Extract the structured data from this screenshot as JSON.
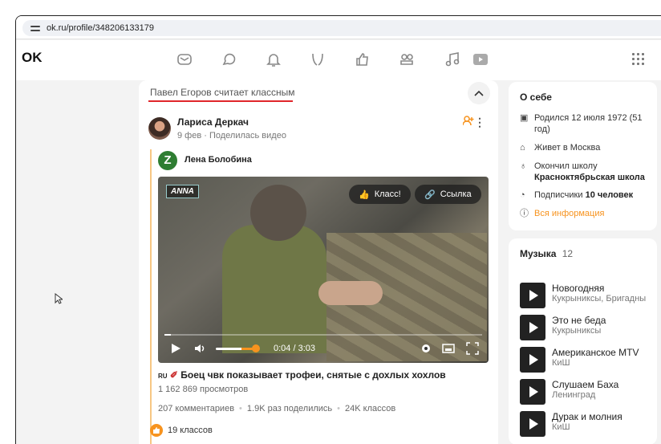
{
  "browser": {
    "url": "ok.ru/profile/348206133179"
  },
  "header": {
    "logo": "OK"
  },
  "feed": {
    "liked_by": "Павел Егоров считает классным",
    "post": {
      "author": "Лариса Деркач",
      "meta": "9 фев · Поделилась видео",
      "repost_author": "Лена Болобина",
      "repost_initial": "Z",
      "video": {
        "channel_logo": "ANNA",
        "like_label": "Класс!",
        "link_label": "Ссылка",
        "time": "0:04 / 3:03",
        "progress": 0.02,
        "volume": 0.8
      },
      "title_prefix": "RU",
      "title": "Боец чвк показывает трофеи, снятые с дохлых хохлов",
      "views": "1 162 869 просмотров",
      "comments": "207 комментариев",
      "shares": "1.9K раз поделились",
      "classes": "24K классов",
      "likes": "19 классов"
    }
  },
  "about": {
    "title": "О себе",
    "born": "Родился 12 июля 1972 (51 год)",
    "lives": "Живет в Москва",
    "school_prefix": "Окончил школу",
    "school": "Красноктябрьская школа",
    "subs_prefix": "Подписчики",
    "subs": "10 человек",
    "all_info": "Вся информация"
  },
  "music": {
    "title": "Музыка",
    "count": "12",
    "tracks": [
      {
        "name": "Новогодняя",
        "artist": "Кукрыниксы, Бригадны"
      },
      {
        "name": "Это не беда",
        "artist": "Кукрыниксы"
      },
      {
        "name": "Американское MTV",
        "artist": "КиШ"
      },
      {
        "name": "Слушаем Баха",
        "artist": "Ленинград"
      },
      {
        "name": "Дурак и молния",
        "artist": "КиШ"
      }
    ]
  },
  "colors": {
    "accent": "#f7931e",
    "underline": "#e0262b",
    "background": "#f3f3f3"
  }
}
